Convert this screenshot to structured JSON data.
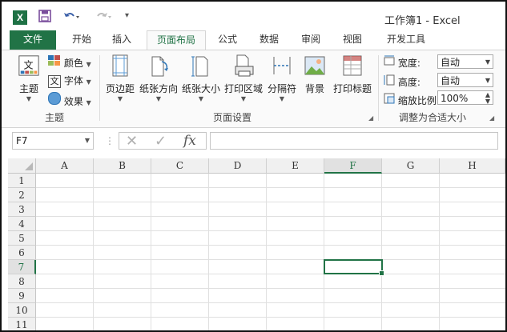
{
  "titlebar": {
    "logo": "X",
    "title": "工作簿1 - Excel",
    "qat": {
      "save_icon": "save-icon",
      "undo_icon": "undo-icon",
      "redo_icon": "redo-icon",
      "customize": "▾"
    }
  },
  "tabs": [
    {
      "label": "文件"
    },
    {
      "label": "开始"
    },
    {
      "label": "插入"
    },
    {
      "label": "页面布局"
    },
    {
      "label": "公式"
    },
    {
      "label": "数据"
    },
    {
      "label": "审阅"
    },
    {
      "label": "视图"
    },
    {
      "label": "开发工具"
    }
  ],
  "ribbon": {
    "theme_group": {
      "label": "主题",
      "themes": "主题",
      "colors": "颜色",
      "fonts": "字体",
      "effects": "效果"
    },
    "page_setup": {
      "label": "页面设置",
      "margins": "页边距",
      "orientation": "纸张方向",
      "size": "纸张大小",
      "print_area": "打印区域",
      "breaks": "分隔符",
      "background": "背景",
      "print_titles": "打印标题"
    },
    "scale_group": {
      "label": "调整为合适大小",
      "width_label": "宽度:",
      "width_value": "自动",
      "height_label": "高度:",
      "height_value": "自动",
      "scale_label": "缩放比例:",
      "scale_value": "100%"
    }
  },
  "formula_bar": {
    "name_box": "F7",
    "formula": "",
    "fx": "fx"
  },
  "grid": {
    "columns": [
      "A",
      "B",
      "C",
      "D",
      "E",
      "F",
      "G",
      "H"
    ],
    "rows": [
      "1",
      "2",
      "3",
      "4",
      "5",
      "6",
      "7",
      "8",
      "9",
      "10",
      "11"
    ],
    "selected_column": "F",
    "selected_row": "7"
  },
  "colors": {
    "accent": "#217346"
  }
}
